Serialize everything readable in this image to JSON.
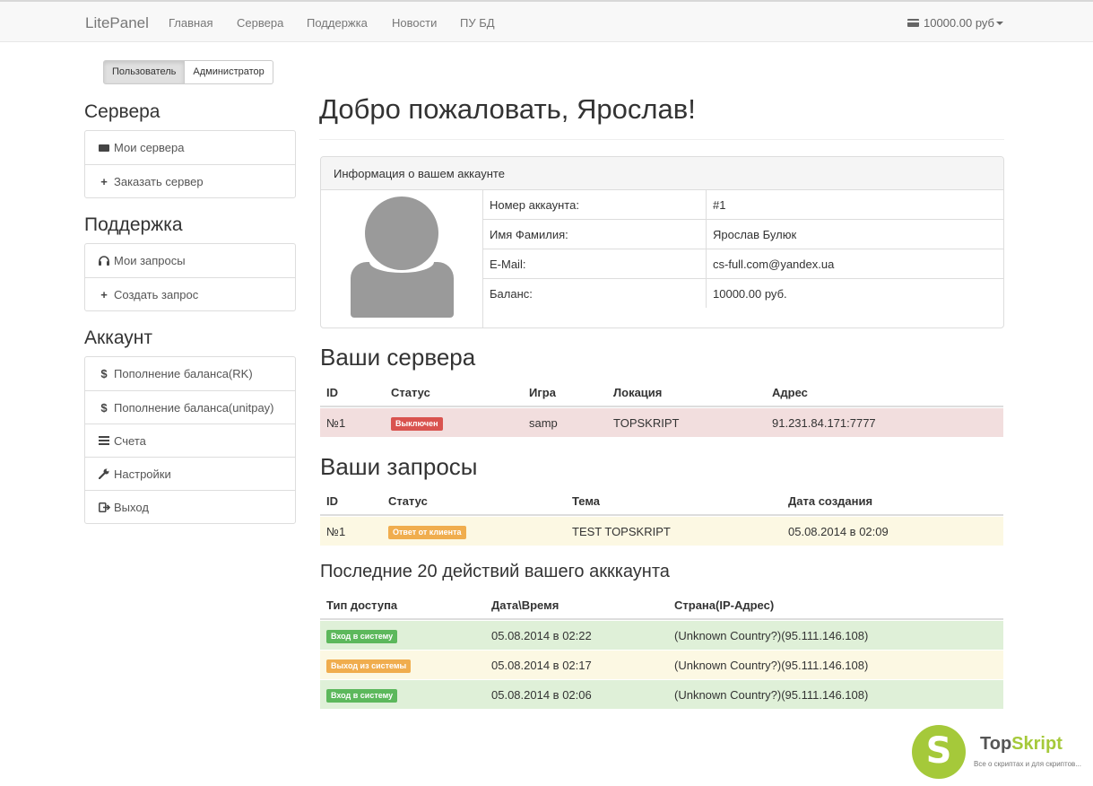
{
  "navbar": {
    "brand": "LitePanel",
    "items": [
      "Главная",
      "Сервера",
      "Поддержка",
      "Новости",
      "ПУ БД"
    ],
    "balance": "10000.00 руб"
  },
  "role_toggle": {
    "user": "Пользователь",
    "admin": "Администратор"
  },
  "sidebar": {
    "servers_heading": "Сервера",
    "servers_items": [
      "Мои сервера",
      "Заказать сервер"
    ],
    "support_heading": "Поддержка",
    "support_items": [
      "Мои запросы",
      "Создать запрос"
    ],
    "account_heading": "Аккаунт",
    "account_items": [
      "Пополнение баланса(RK)",
      "Пополнение баланса(unitpay)",
      "Счета",
      "Настройки",
      "Выход"
    ]
  },
  "main": {
    "title": "Добро пожаловать, Ярослав!",
    "account_panel": {
      "heading": "Информация о вашем аккаунте",
      "rows": [
        {
          "key": "Номер аккаунта:",
          "value": "#1"
        },
        {
          "key": "Имя Фамилия:",
          "value": "Ярослав Булюк"
        },
        {
          "key": "E-Mail:",
          "value": "cs-full.com@yandex.ua"
        },
        {
          "key": "Баланс:",
          "value": "10000.00 руб."
        }
      ]
    },
    "servers": {
      "title": "Ваши сервера",
      "headers": [
        "ID",
        "Статус",
        "Игра",
        "Локация",
        "Адрес"
      ],
      "rows": [
        {
          "id": "№1",
          "status": "Выключен",
          "game": "samp",
          "location": "TOPSKRIPT",
          "address": "91.231.84.171:7777"
        }
      ]
    },
    "tickets": {
      "title": "Ваши запросы",
      "headers": [
        "ID",
        "Статус",
        "Тема",
        "Дата создания"
      ],
      "rows": [
        {
          "id": "№1",
          "status": "Ответ от клиента",
          "subject": "TEST TOPSKRIPT",
          "created": "05.08.2014 в 02:09"
        }
      ]
    },
    "activity": {
      "title": "Последние 20 действий вашего акккаунта",
      "headers": [
        "Тип доступа",
        "Дата\\Время",
        "Страна(IP-Адрес)"
      ],
      "rows": [
        {
          "type": "Вход в систему",
          "datetime": "05.08.2014 в 02:22",
          "country": "(Unknown Country?)(95.111.146.108)"
        },
        {
          "type": "Выход из системы",
          "datetime": "05.08.2014 в 02:17",
          "country": "(Unknown Country?)(95.111.146.108)"
        },
        {
          "type": "Вход в систему",
          "datetime": "05.08.2014 в 02:06",
          "country": "(Unknown Country?)(95.111.146.108)"
        }
      ]
    }
  },
  "watermark": {
    "brand_a": "Top",
    "brand_b": "Skript",
    "tagline": "Все о скриптах и для скриптов..."
  },
  "colors": {
    "danger": "#d9534f",
    "warning": "#f0ad4e",
    "success": "#5cb85c",
    "logo_green": "#a5c93a"
  }
}
